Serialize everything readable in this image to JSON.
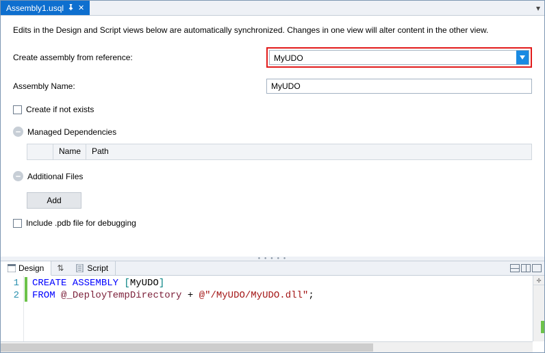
{
  "tab": {
    "title": "Assembly1.usql"
  },
  "info": "Edits in the Design and Script views below are automatically synchronized. Changes in one view will alter content in the other view.",
  "form": {
    "reference_label": "Create assembly from reference:",
    "reference_value": "MyUDO",
    "name_label": "Assembly Name:",
    "name_value": "MyUDO",
    "create_if_not_exists_label": "Create if not exists",
    "managed_deps_label": "Managed Dependencies",
    "deps_cols": {
      "name": "Name",
      "path": "Path"
    },
    "additional_files_label": "Additional Files",
    "add_btn": "Add",
    "include_pdb_label": "Include .pdb file for debugging"
  },
  "bottom_tabs": {
    "design": "Design",
    "script": "Script"
  },
  "code": {
    "lines": [
      1,
      2
    ],
    "l1_kw": "CREATE ASSEMBLY ",
    "l1_br_open": "[",
    "l1_name": "MyUDO",
    "l1_br_close": "]",
    "l2_kw": "FROM ",
    "l2_var": "@_DeployTempDirectory",
    "l2_plus": " + ",
    "l2_str": "@\"/MyUDO/MyUDO.dll\"",
    "l2_semi": ";"
  }
}
